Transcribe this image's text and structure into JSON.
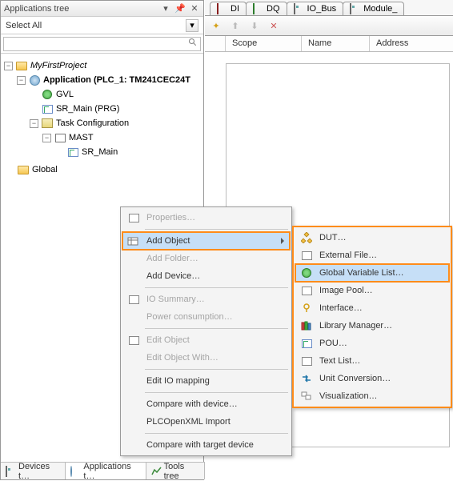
{
  "panel": {
    "title": "Applications tree",
    "select_all": "Select All"
  },
  "tree": {
    "project": "MyFirstProject",
    "application": "Application (PLC_1: TM241CEC24T",
    "gvl": "GVL",
    "sr_main": "SR_Main (PRG)",
    "task_cfg": "Task Configuration",
    "mast": "MAST",
    "sr_main2": "SR_Main",
    "global": "Global"
  },
  "bottom_tabs": {
    "devices": "Devices t…",
    "applications": "Applications t…",
    "tools": "Tools tree"
  },
  "editor_tabs": {
    "di": "DI",
    "dq": "DQ",
    "io_bus": "IO_Bus",
    "module": "Module_"
  },
  "cols": {
    "scope": "Scope",
    "name": "Name",
    "address": "Address"
  },
  "menu1": {
    "properties": "Properties…",
    "add_object": "Add Object",
    "add_folder": "Add Folder…",
    "add_device": "Add Device…",
    "io_summary": "IO Summary…",
    "power": "Power consumption…",
    "edit_object": "Edit Object",
    "edit_object_with": "Edit Object With…",
    "edit_io": "Edit IO mapping",
    "compare_device": "Compare with device…",
    "plcopen": "PLCOpenXML Import",
    "compare_target": "Compare with target device"
  },
  "menu2": {
    "dut": "DUT…",
    "external_file": "External File…",
    "gvl": "Global Variable List…",
    "image_pool": "Image Pool…",
    "interface": "Interface…",
    "lib_mgr": "Library Manager…",
    "pou": "POU…",
    "text_list": "Text List…",
    "unit_conv": "Unit Conversion…",
    "visualization": "Visualization…"
  }
}
